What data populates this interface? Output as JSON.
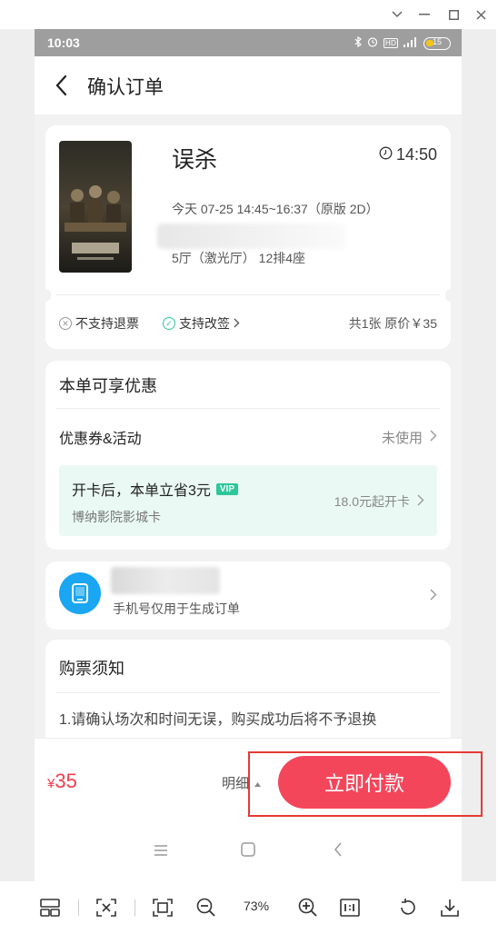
{
  "status": {
    "time": "10:03",
    "battery": "15"
  },
  "nav": {
    "title": "确认订单"
  },
  "movie": {
    "name": "误杀",
    "start_time": "14:50",
    "schedule": "今天 07-25 14:45~16:37（原版 2D）",
    "hall_seat": "5厅（激光厅） 12排4座",
    "no_refund": "不支持退票",
    "support_change": "支持改签",
    "ticket_summary": "共1张 原价￥35"
  },
  "discount": {
    "title": "本单可享优惠",
    "coupon_label": "优惠券&活动",
    "coupon_value": "未使用",
    "promo_head": "开卡后，本单立省3元",
    "vip_badge": "VIP",
    "promo_sub": "博纳影院影城卡",
    "promo_price": "18.0元起开卡"
  },
  "phone_card": {
    "note": "手机号仅用于生成订单"
  },
  "notice": {
    "title": "购票须知",
    "line1": "1.请确认场次和时间无误，购买成功后将不予退换"
  },
  "paybar": {
    "currency": "¥",
    "amount": "35",
    "detail": "明细",
    "pay_button": "立即付款"
  },
  "viewer": {
    "zoom": "73%"
  }
}
